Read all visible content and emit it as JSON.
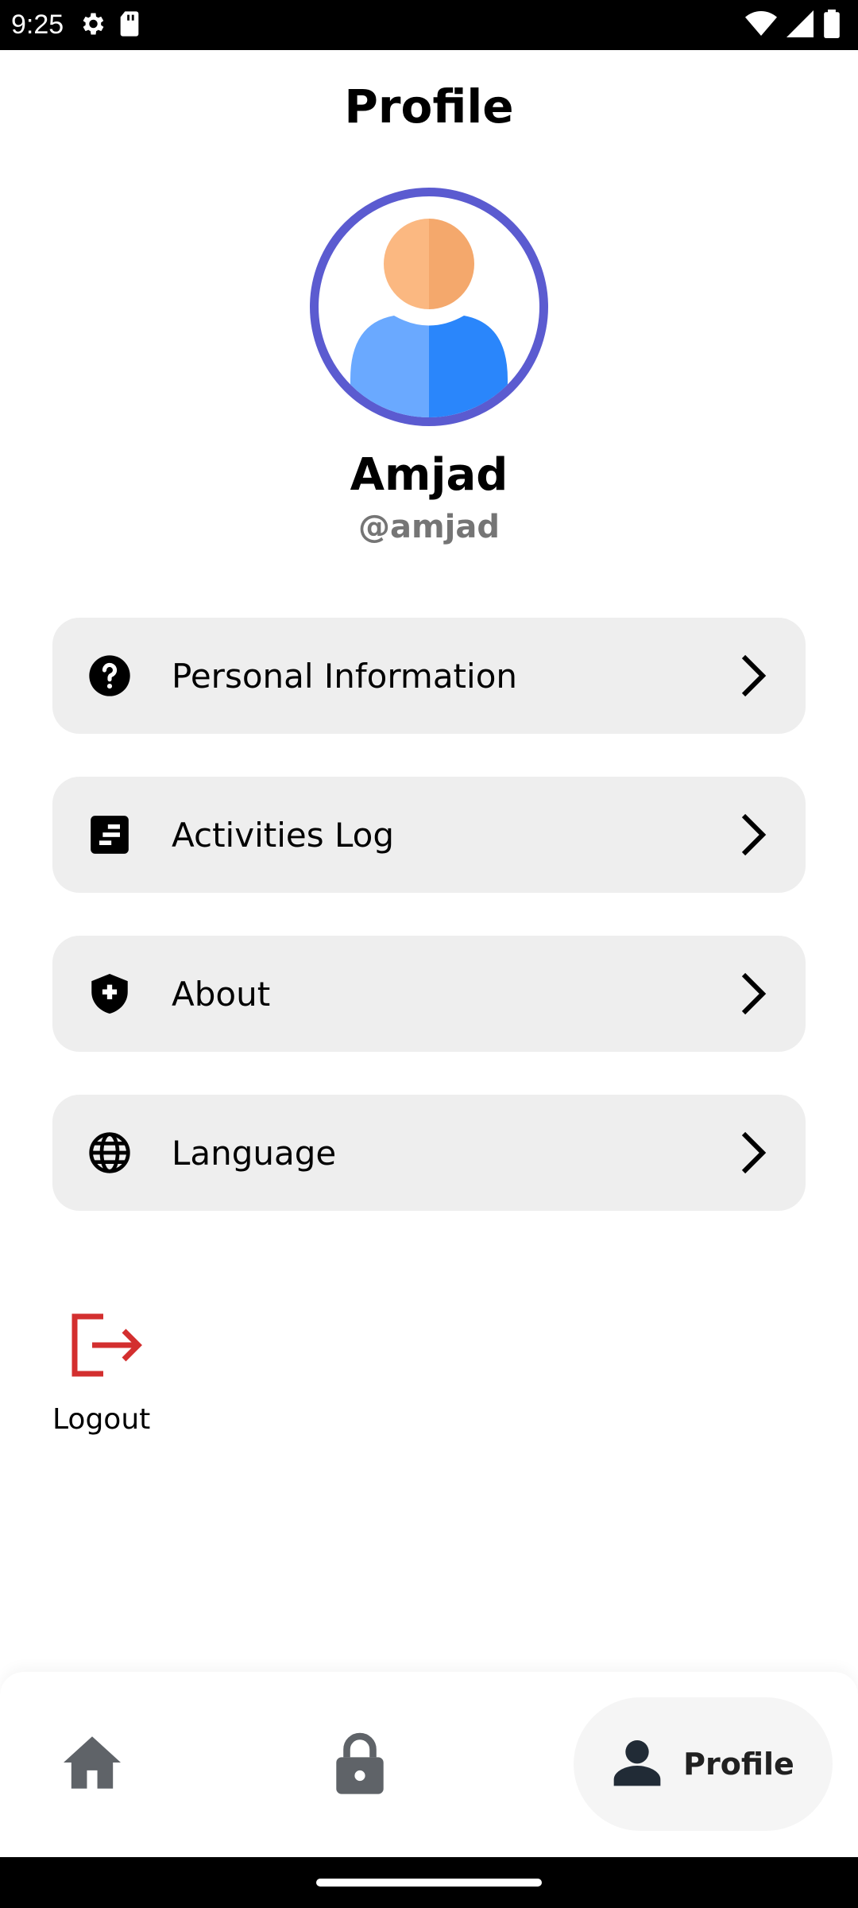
{
  "status_bar": {
    "time": "9:25",
    "icons": [
      "settings-icon",
      "sd-card-icon",
      "wifi-icon",
      "signal-icon",
      "battery-icon"
    ]
  },
  "header": {
    "title": "Profile"
  },
  "profile": {
    "name": "Amjad",
    "handle": "@amjad",
    "avatar_ring_color": "#5b5bd0"
  },
  "menu": {
    "items": [
      {
        "label": "Personal Information",
        "icon": "help-circle-icon"
      },
      {
        "label": "Activities Log",
        "icon": "log-icon"
      },
      {
        "label": "About",
        "icon": "shield-plus-icon"
      },
      {
        "label": "Language",
        "icon": "globe-icon"
      }
    ]
  },
  "logout": {
    "label": "Logout",
    "color": "#d32f2f"
  },
  "bottom_nav": {
    "items": [
      {
        "icon": "home-icon",
        "label": ""
      },
      {
        "icon": "lock-icon",
        "label": ""
      },
      {
        "icon": "person-icon",
        "label": "Profile",
        "active": true
      }
    ]
  }
}
